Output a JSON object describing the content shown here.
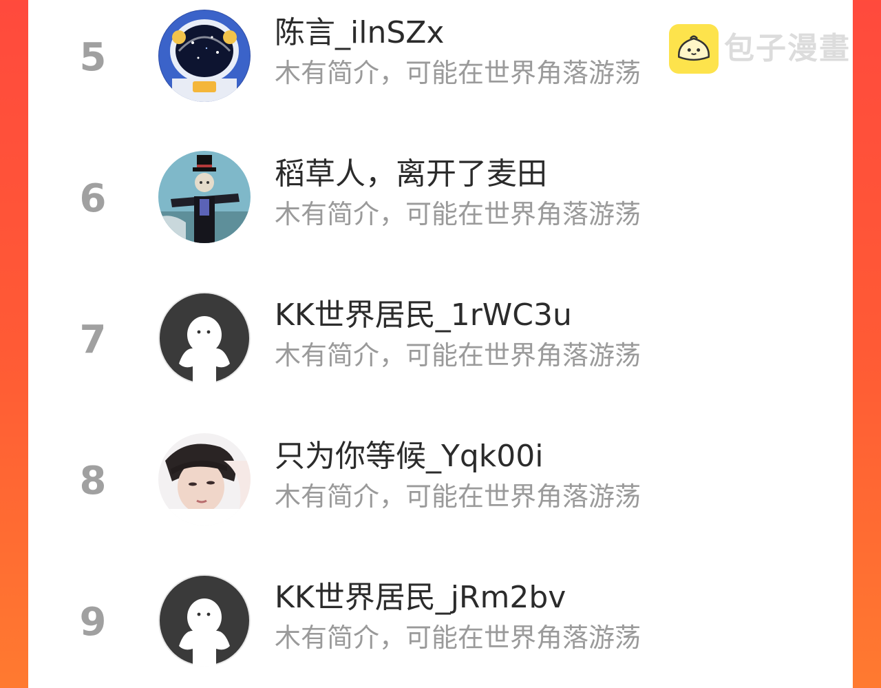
{
  "watermark": {
    "text": "包子漫畫",
    "icon": "bun-logo-icon"
  },
  "users": [
    {
      "rank": "5",
      "name": "陈言_ilnSZx",
      "bio": "木有简介，可能在世界角落游荡",
      "avatar": "astronaut-avatar"
    },
    {
      "rank": "6",
      "name": "稻草人，离开了麦田",
      "bio": "木有简介，可能在世界角落游荡",
      "avatar": "scarecrow-avatar"
    },
    {
      "rank": "7",
      "name": "KK世界居民_1rWC3u",
      "bio": "木有简介，可能在世界角落游荡",
      "avatar": "default-avatar"
    },
    {
      "rank": "8",
      "name": "只为你等候_Yqk00i",
      "bio": "木有简介，可能在世界角落游荡",
      "avatar": "photo-avatar"
    },
    {
      "rank": "9",
      "name": "KK世界居民_jRm2bv",
      "bio": "木有简介，可能在世界角落游荡",
      "avatar": "default-avatar"
    }
  ]
}
